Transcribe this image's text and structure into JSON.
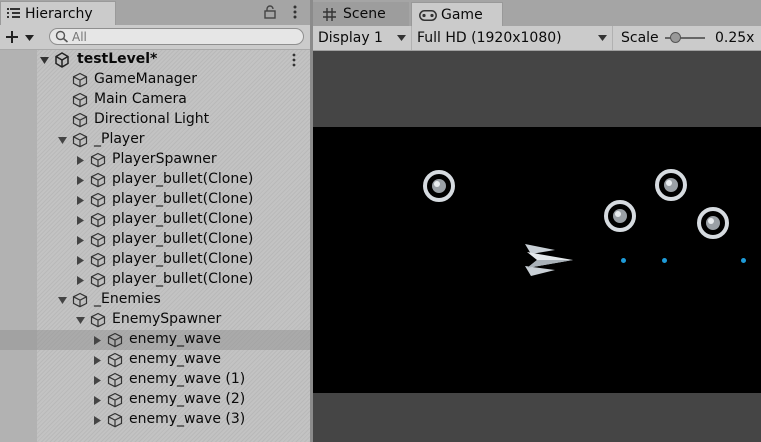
{
  "hierarchy": {
    "tab_label": "Hierarchy",
    "search_placeholder": "All",
    "scene_name": "testLevel*",
    "rows": [
      {
        "label": "GameManager"
      },
      {
        "label": "Main Camera"
      },
      {
        "label": "Directional Light"
      },
      {
        "label": "_Player"
      },
      {
        "label": "PlayerSpawner"
      },
      {
        "label": "player_bullet(Clone)"
      },
      {
        "label": "player_bullet(Clone)"
      },
      {
        "label": "player_bullet(Clone)"
      },
      {
        "label": "player_bullet(Clone)"
      },
      {
        "label": "player_bullet(Clone)"
      },
      {
        "label": "player_bullet(Clone)"
      },
      {
        "label": "_Enemies"
      },
      {
        "label": "EnemySpawner"
      },
      {
        "label": "enemy_wave"
      },
      {
        "label": "enemy_wave"
      },
      {
        "label": "enemy_wave (1)"
      },
      {
        "label": "enemy_wave (2)"
      },
      {
        "label": "enemy_wave (3)"
      }
    ]
  },
  "game": {
    "scene_tab_label": "Scene",
    "game_tab_label": "Game",
    "display_label": "Display 1",
    "resolution_label": "Full HD (1920x1080)",
    "scale_label": "Scale",
    "scale_value": "0.25x",
    "scale_level": 0.1
  },
  "colors": {
    "bullet": "#1e9bd8",
    "viewport": "#000000",
    "panel": "#c2c2c2"
  },
  "icons": [
    "hierarchy-icon",
    "lock-icon",
    "kebab-menu-icon",
    "plus-icon",
    "search-icon",
    "unity-logo-icon",
    "gameobject-cube-icon",
    "expand-arrow-icon",
    "collapse-arrow-icon",
    "scene-grid-icon",
    "gamepad-icon",
    "dropdown-arrow-icon"
  ]
}
